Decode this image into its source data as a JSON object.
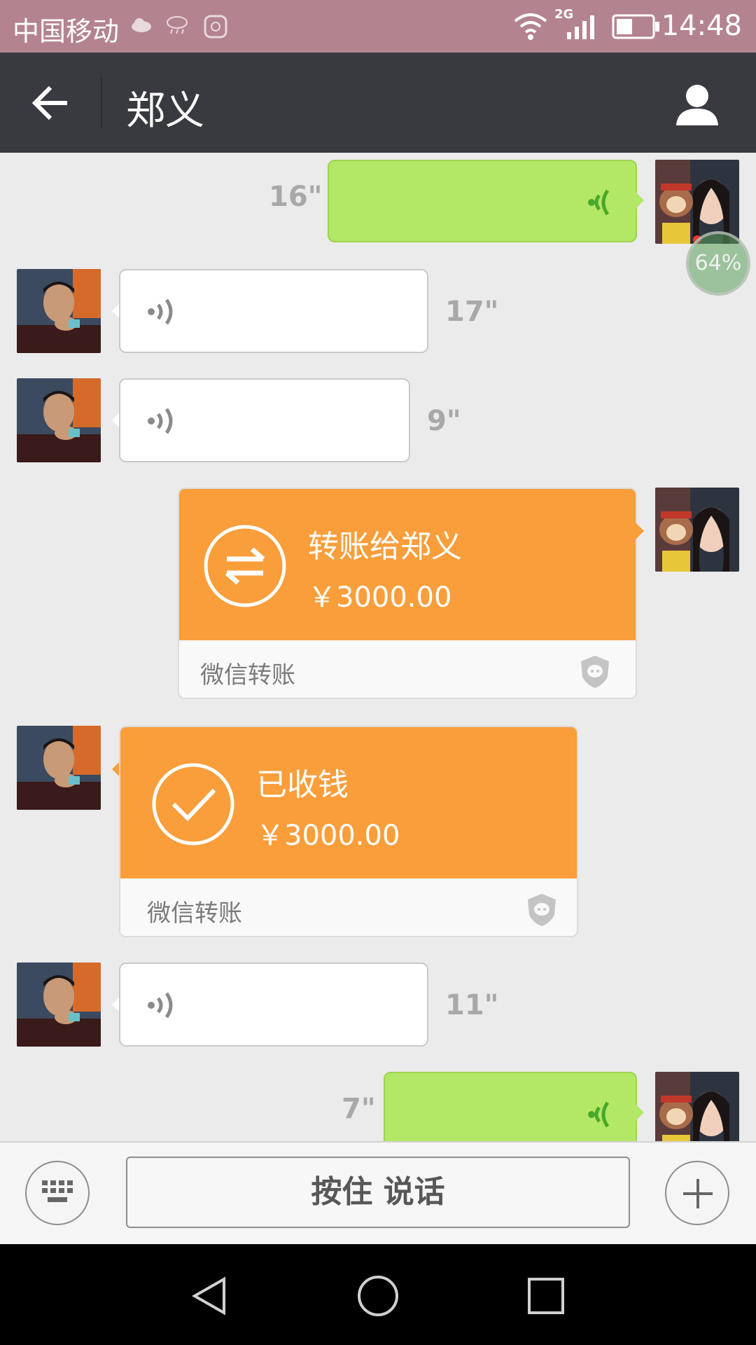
{
  "status_bar": {
    "carrier": "中国移动",
    "network": "2G",
    "time": "14:48",
    "battery_level": 0.45
  },
  "header": {
    "title": "郑义",
    "back_icon": "arrow-left-icon",
    "profile_icon": "person-icon"
  },
  "messages": {
    "m1": {
      "sender": "me",
      "type": "voice",
      "duration": "16\"",
      "upload_progress": "64%"
    },
    "m2": {
      "sender": "contact",
      "type": "voice",
      "duration": "17\""
    },
    "m3": {
      "sender": "contact",
      "type": "voice",
      "duration": "9\""
    },
    "m4": {
      "sender": "me",
      "type": "transfer",
      "title": "转账给郑义",
      "amount": "￥3000.00",
      "footer": "微信转账"
    },
    "m5": {
      "sender": "contact",
      "type": "transfer_received",
      "title": "已收钱",
      "amount": "￥3000.00",
      "footer": "微信转账"
    },
    "m6": {
      "sender": "contact",
      "type": "voice",
      "duration": "11\""
    },
    "m7": {
      "sender": "me",
      "type": "voice",
      "duration": "7\""
    }
  },
  "input": {
    "hold_to_talk_label": "按住 说话",
    "keyboard_icon": "keyboard-icon",
    "plus_icon": "plus-icon"
  },
  "colors": {
    "status_bar": "#b48390",
    "title_bar": "#393a3f",
    "chat_bg": "#ebebeb",
    "outgoing_bubble": "#b3e866",
    "transfer_orange": "#f99e3b"
  }
}
